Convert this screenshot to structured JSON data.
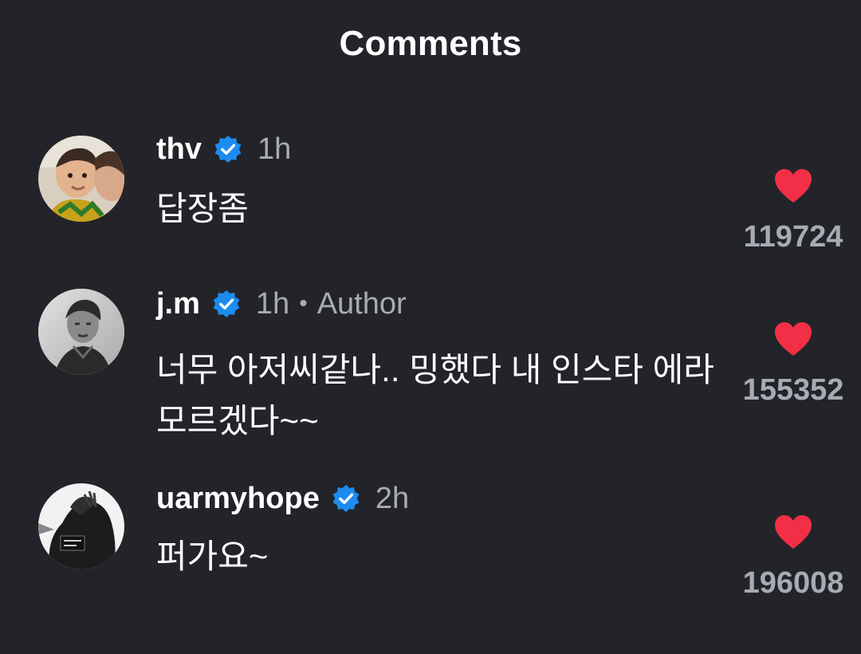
{
  "header": {
    "title": "Comments"
  },
  "comments": [
    {
      "username": "thv",
      "verified": true,
      "time": "1h",
      "author_label": "",
      "text": "답장좀",
      "likes": "119724",
      "avatar_icon": "child-photo-avatar"
    },
    {
      "username": "j.m",
      "verified": true,
      "time": "1h",
      "author_label": "Author",
      "separator": "•",
      "text": "너무 아저씨같나.. 밍했다 내 인스타 에라 모르겠다~~",
      "likes": "155352",
      "avatar_icon": "bw-portrait-avatar"
    },
    {
      "username": "uarmyhope",
      "verified": true,
      "time": "2h",
      "author_label": "",
      "text": "퍼가요~",
      "likes": "196008",
      "avatar_icon": "dark-photo-avatar"
    }
  ],
  "colors": {
    "background": "#232429",
    "verified_badge": "#1d8bf0",
    "heart": "#f22f46",
    "secondary_text": "#a8abb3"
  }
}
